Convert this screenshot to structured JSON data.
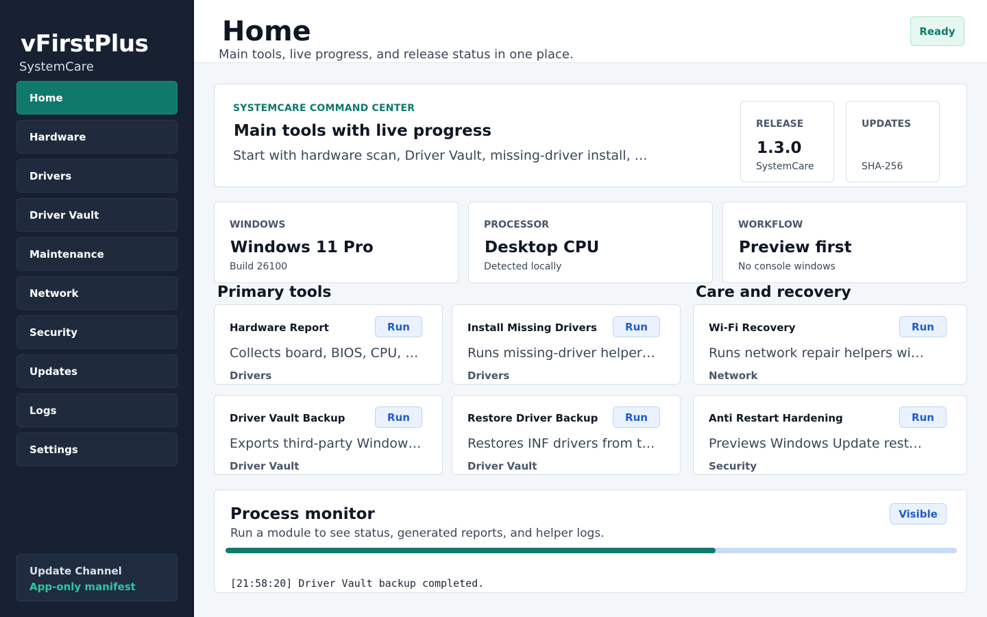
{
  "sidebar": {
    "brand": "vFirstPlus",
    "brand_sub": "SystemCare",
    "items": [
      {
        "label": "Home",
        "active": true
      },
      {
        "label": "Hardware"
      },
      {
        "label": "Drivers"
      },
      {
        "label": "Driver Vault"
      },
      {
        "label": "Maintenance"
      },
      {
        "label": "Network"
      },
      {
        "label": "Security"
      },
      {
        "label": "Updates"
      },
      {
        "label": "Logs"
      },
      {
        "label": "Settings"
      }
    ],
    "channel": {
      "title": "Update Channel",
      "value": "App-only manifest"
    }
  },
  "header": {
    "title": "Home",
    "subtitle": "Main tools, live progress, and release status in one place.",
    "status": "Ready"
  },
  "hero": {
    "eyebrow": "SYSTEMCARE COMMAND CENTER",
    "title": "Main tools with live progress",
    "description": "Start with hardware scan, Driver Vault, missing-driver install, Wi-Fi recovery, and update checks.",
    "release": {
      "label": "RELEASE",
      "value": "1.3.0",
      "sub": "SystemCare"
    },
    "updates": {
      "label": "UPDATES",
      "value": "",
      "sub": "SHA-256"
    }
  },
  "stats": [
    {
      "label": "WINDOWS",
      "value": "Windows 11 Pro",
      "sub": "Build 26100"
    },
    {
      "label": "PROCESSOR",
      "value": "Desktop CPU",
      "sub": "Detected locally"
    },
    {
      "label": "WORKFLOW",
      "value": "Preview first",
      "sub": "No console windows"
    }
  ],
  "sections": {
    "primary": "Primary tools",
    "care": "Care and recovery"
  },
  "tools": [
    {
      "name": "Hardware Report",
      "run": "Run",
      "description": "Collects board, BIOS, CPU, GPU and storage details.",
      "category": "Drivers"
    },
    {
      "name": "Install Missing Drivers",
      "run": "Run",
      "description": "Runs missing-driver helpers with preview.",
      "category": "Drivers"
    },
    {
      "name": "Wi-Fi Recovery",
      "run": "Run",
      "description": "Runs network repair helpers with preview.",
      "category": "Network"
    },
    {
      "name": "Driver Vault Backup",
      "run": "Run",
      "description": "Exports third-party Windows drivers to the vault.",
      "category": "Driver Vault"
    },
    {
      "name": "Restore Driver Backup",
      "run": "Run",
      "description": "Restores INF drivers from the vault folder.",
      "category": "Driver Vault"
    },
    {
      "name": "Anti Restart Hardening",
      "run": "Run",
      "description": "Previews Windows Update restart policies.",
      "category": "Security"
    }
  ],
  "monitor": {
    "title": "Process monitor",
    "subtitle": "Run a module to see status, generated reports, and helper logs.",
    "visibility": "Visible",
    "progress": 0.67,
    "log": "[21:58:20] Driver Vault backup completed."
  }
}
